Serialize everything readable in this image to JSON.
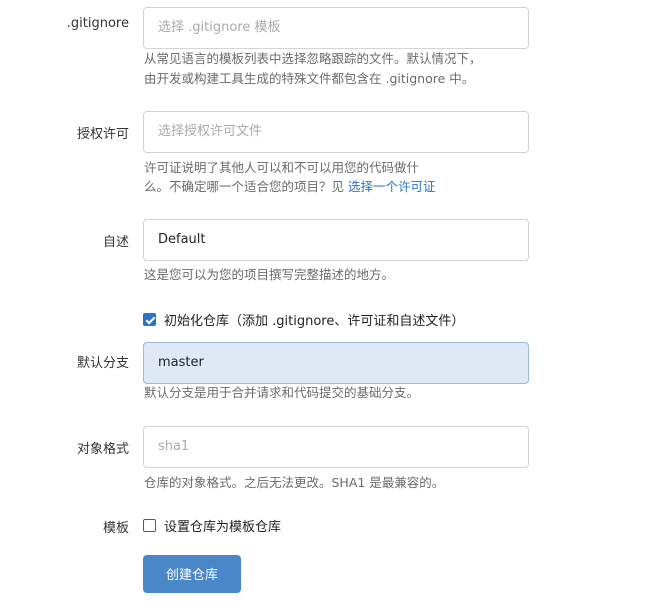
{
  "gitignore": {
    "label": ".gitignore",
    "placeholder": "选择 .gitignore 模板",
    "help_line1": "从常见语言的模板列表中选择忽略跟踪的文件。默认情况下，",
    "help_line2": "由开发或构建工具生成的特殊文件都包含在 .gitignore 中。"
  },
  "license": {
    "label": "授权许可",
    "placeholder": "选择授权许可文件",
    "help_line1": "许可证说明了其他人可以和不可以用您的代码做什",
    "help_line2": "么。不确定哪一个适合您的项目？见 ",
    "help_link": "选择一个许可证"
  },
  "readme": {
    "label": "自述",
    "value": "Default",
    "help": "这是您可以为您的项目撰写完整描述的地方。"
  },
  "auto_init": {
    "checked": true,
    "label": "初始化仓库（添加 .gitignore、许可证和自述文件）"
  },
  "default_branch": {
    "label": "默认分支",
    "value": "master",
    "help": "默认分支是用于合并请求和代码提交的基础分支。"
  },
  "object_format": {
    "label": "对象格式",
    "value": "sha1",
    "help": "仓库的对象格式。之后无法更改。SHA1 是最兼容的。"
  },
  "template": {
    "label": "模板",
    "checked": false,
    "checkbox_label": "设置仓库为模板仓库"
  },
  "submit": {
    "label": "创建仓库",
    "color": "#4a87c8"
  },
  "colors": {
    "link": "#2a73c5",
    "focused_input_bg": "#dfe9f5"
  }
}
